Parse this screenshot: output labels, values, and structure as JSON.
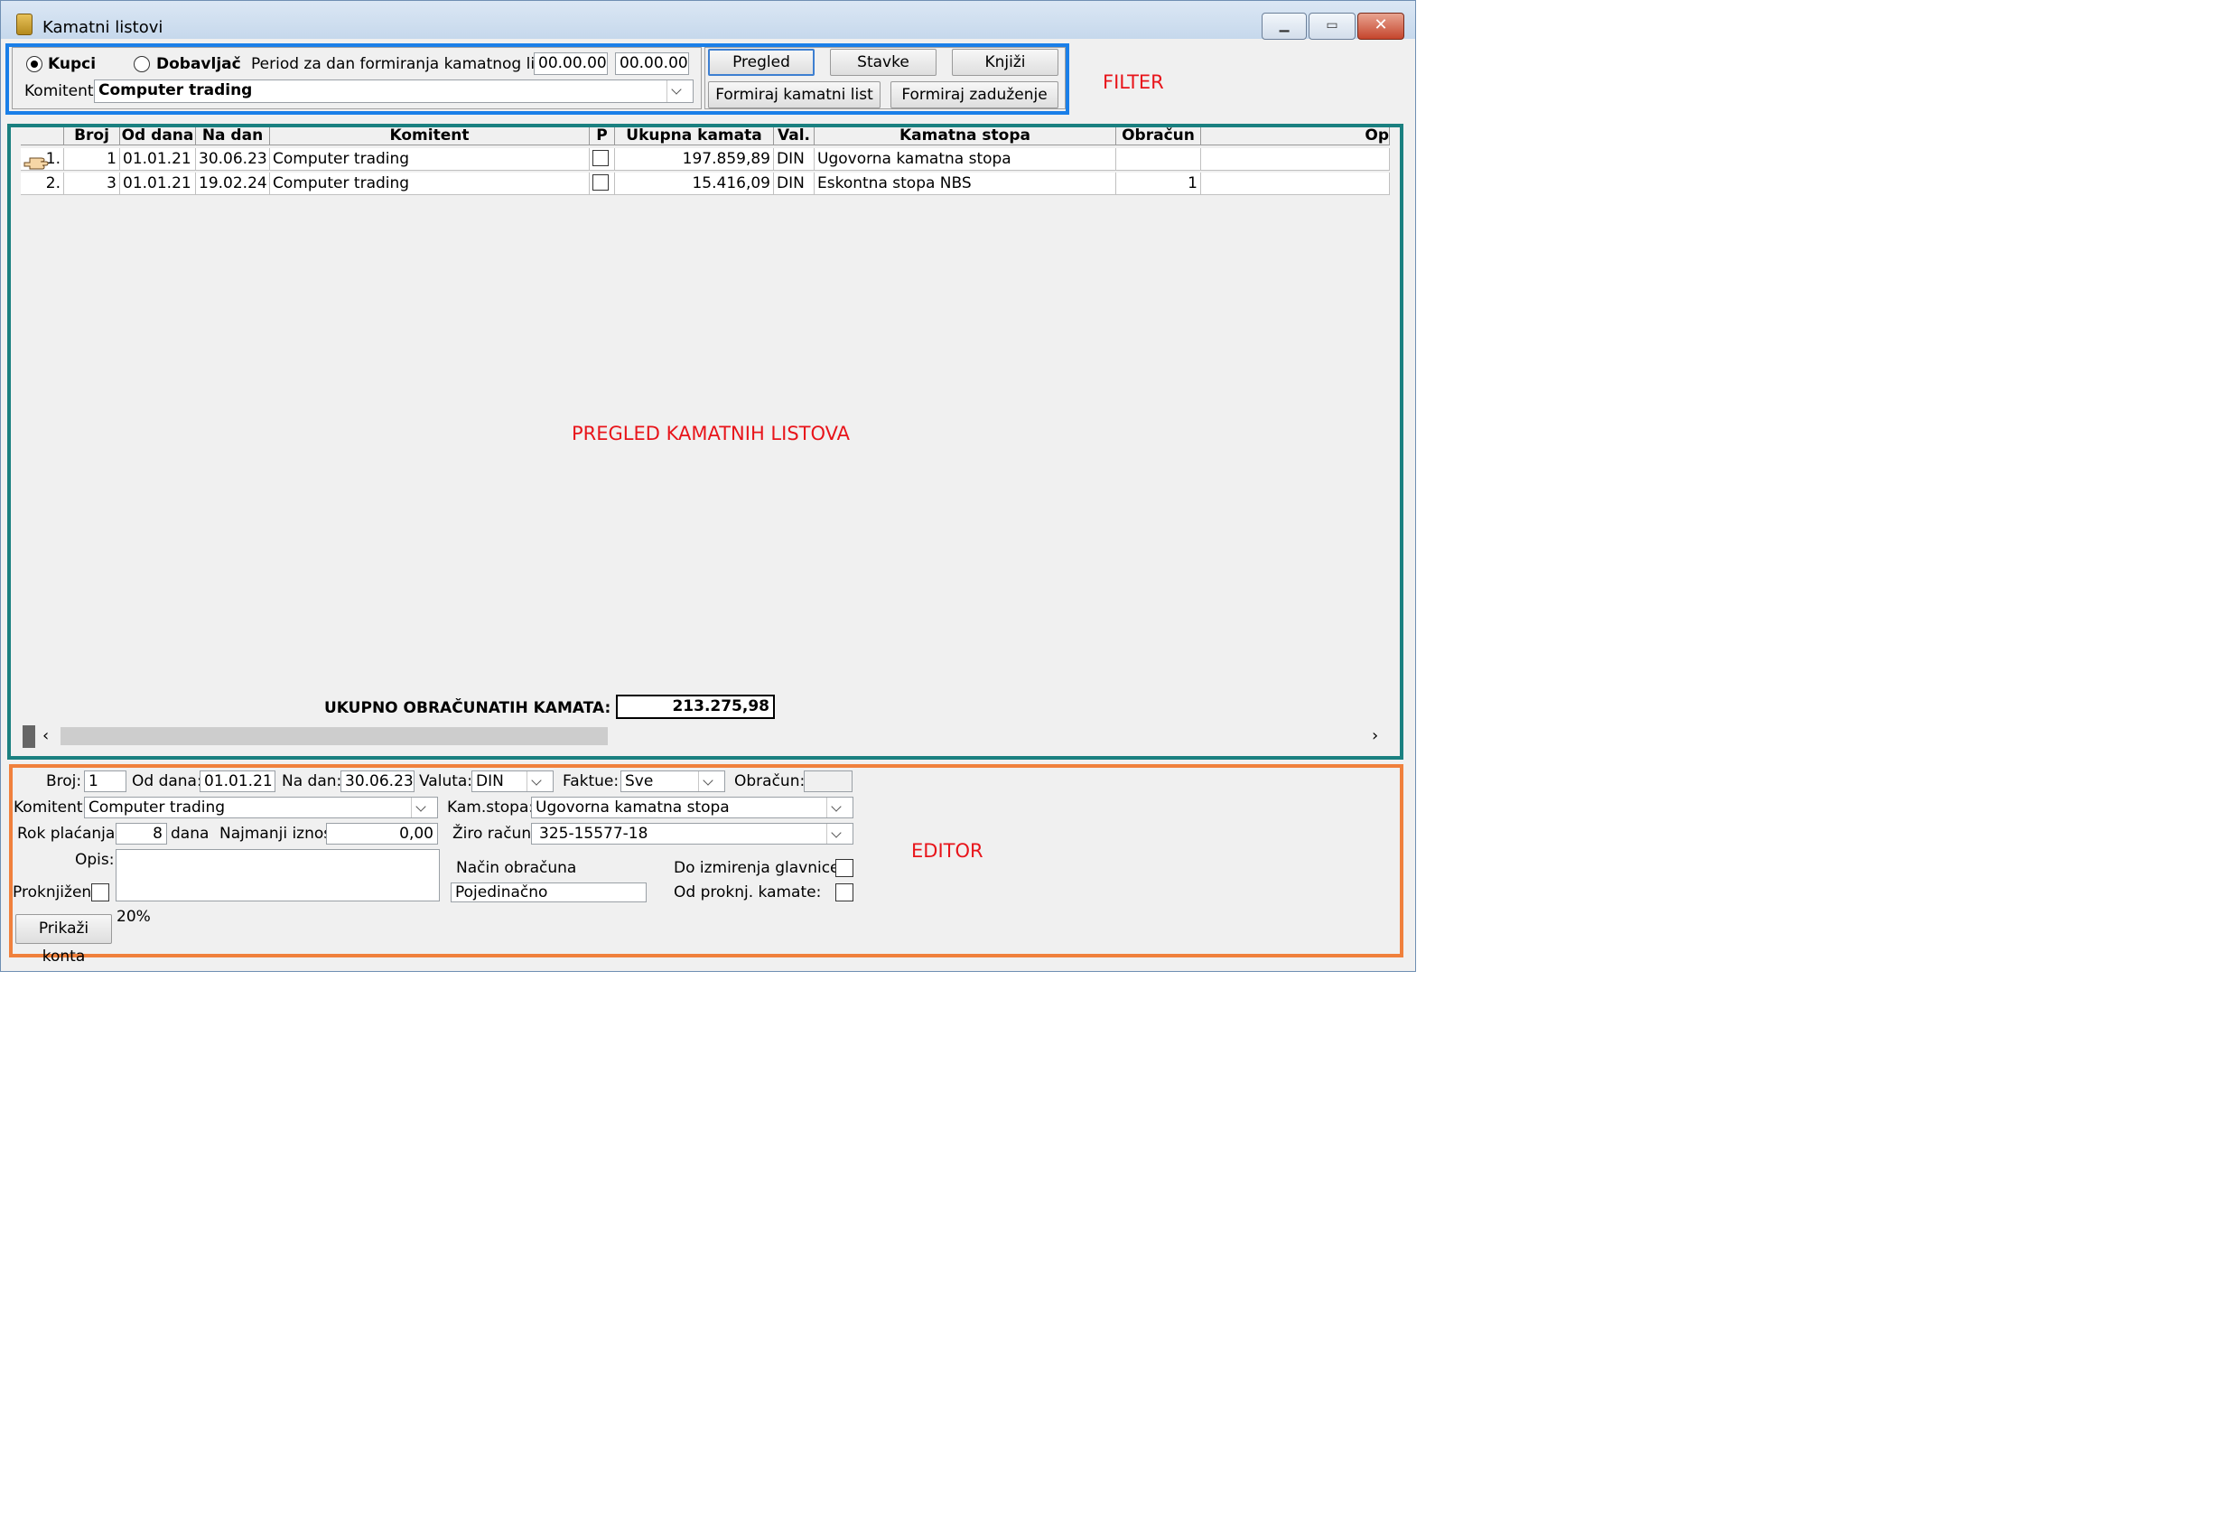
{
  "window": {
    "title": "Kamatni listovi"
  },
  "annotations": {
    "filter": "FILTER",
    "grid": "PREGLED KAMATNIH LISTOVA",
    "editor": "EDITOR"
  },
  "filter": {
    "radio_kupci": "Kupci",
    "radio_dobavljac": "Dobavljač",
    "selected": "Kupci",
    "period_label": "Period za dan formiranja kamatnog lista:",
    "period_from": "00.00.00",
    "period_to": "00.00.00",
    "komitent_label": "Komitent:",
    "komitent_value": "Computer trading"
  },
  "buttons": {
    "pregled": "Pregled",
    "stavke": "Stavke",
    "knjizi": "Knjiži",
    "formiraj_kamatni_list": "Formiraj kamatni list",
    "formiraj_zaduzenje": "Formiraj zaduženje",
    "prikazi_konta": "Prikaži konta"
  },
  "grid": {
    "columns": [
      "Broj",
      "Od dana",
      "Na dan",
      "Komitent",
      "P",
      "Ukupna kamata",
      "Val.",
      "Kamatna stopa",
      "Obračun",
      "Op"
    ],
    "rows": [
      {
        "idx": "1.",
        "broj": "1",
        "od_dana": "01.01.21",
        "na_dan": "30.06.23",
        "komitent": "Computer trading",
        "p": false,
        "ukupna_kamata": "197.859,89",
        "val": "DIN",
        "kamatna_stopa": "Ugovorna kamatna stopa",
        "obracun": ""
      },
      {
        "idx": "2.",
        "broj": "3",
        "od_dana": "01.01.21",
        "na_dan": "19.02.24",
        "komitent": "Computer trading",
        "p": false,
        "ukupna_kamata": "15.416,09",
        "val": "DIN",
        "kamatna_stopa": "Eskontna stopa NBS",
        "obracun": "1"
      }
    ],
    "total_label": "UKUPNO OBRAČUNATIH KAMATA:",
    "total_value": "213.275,98"
  },
  "editor": {
    "broj_label": "Broj:",
    "broj": "1",
    "od_dana_label": "Od dana:",
    "od_dana": "01.01.21",
    "na_dan_label": "Na dan:",
    "na_dan": "30.06.23",
    "valuta_label": "Valuta:",
    "valuta": "DIN",
    "faktue_label": "Faktue:",
    "faktue": "Sve",
    "obracun_label": "Obračun:",
    "obracun": "",
    "komitent_label": "Komitent:",
    "komitent": "Computer trading",
    "kam_stopa_label": "Kam.stopa:",
    "kam_stopa": "Ugovorna kamatna stopa",
    "rok_label": "Rok plaćanja:",
    "rok": "8",
    "dana": "dana",
    "najmanji_label": "Najmanji iznos:",
    "najmanji": "0,00",
    "ziro_label": "Žiro račun:",
    "ziro": "325-15577-18",
    "opis_label": "Opis:",
    "opis": "",
    "nacin_label": "Način obračuna",
    "nacin": "Pojedinačno",
    "do_izmirenja_label": "Do izmirenja glavnice:",
    "od_proknj_label": "Od proknj. kamate:",
    "proknjizen_label": "Proknjižen",
    "percent": "20%"
  },
  "colors": {
    "filter_frame": "#1a7fe8",
    "grid_frame": "#1a8080",
    "editor_frame": "#f0803c",
    "annotation": "#e8141a"
  }
}
